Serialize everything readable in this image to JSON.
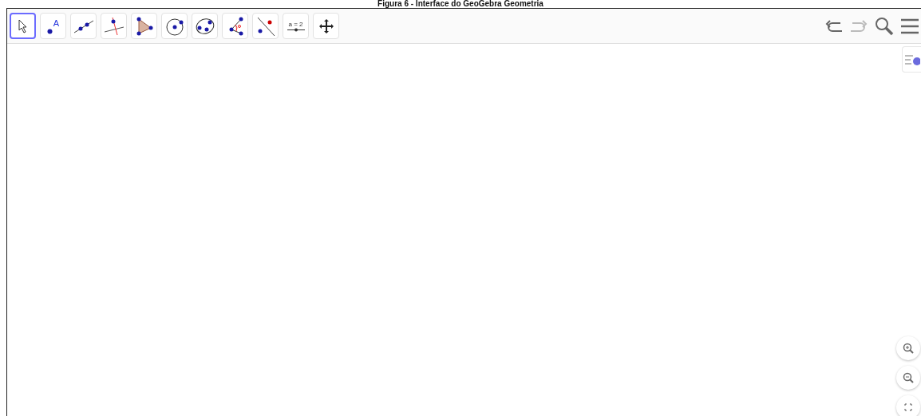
{
  "caption": "Figura 6 - Interface do GeoGebra Geometria",
  "toolbar": {
    "tools": [
      {
        "kind": "move",
        "selected": true
      },
      {
        "kind": "point",
        "selected": false,
        "label": "A"
      },
      {
        "kind": "line",
        "selected": false
      },
      {
        "kind": "perpendicular",
        "selected": false
      },
      {
        "kind": "polygon",
        "selected": false
      },
      {
        "kind": "circle",
        "selected": false
      },
      {
        "kind": "conic",
        "selected": false
      },
      {
        "kind": "angle",
        "selected": false
      },
      {
        "kind": "reflect",
        "selected": false
      },
      {
        "kind": "slider",
        "selected": false,
        "label": "a = 2"
      },
      {
        "kind": "move_view",
        "selected": false
      }
    ],
    "actions": [
      {
        "kind": "undo",
        "disabled": false
      },
      {
        "kind": "redo",
        "disabled": true
      },
      {
        "kind": "search",
        "disabled": false
      },
      {
        "kind": "menu",
        "disabled": false
      }
    ]
  },
  "view_controls": [
    {
      "kind": "zoom_in"
    },
    {
      "kind": "zoom_out"
    },
    {
      "kind": "fullscreen"
    }
  ]
}
